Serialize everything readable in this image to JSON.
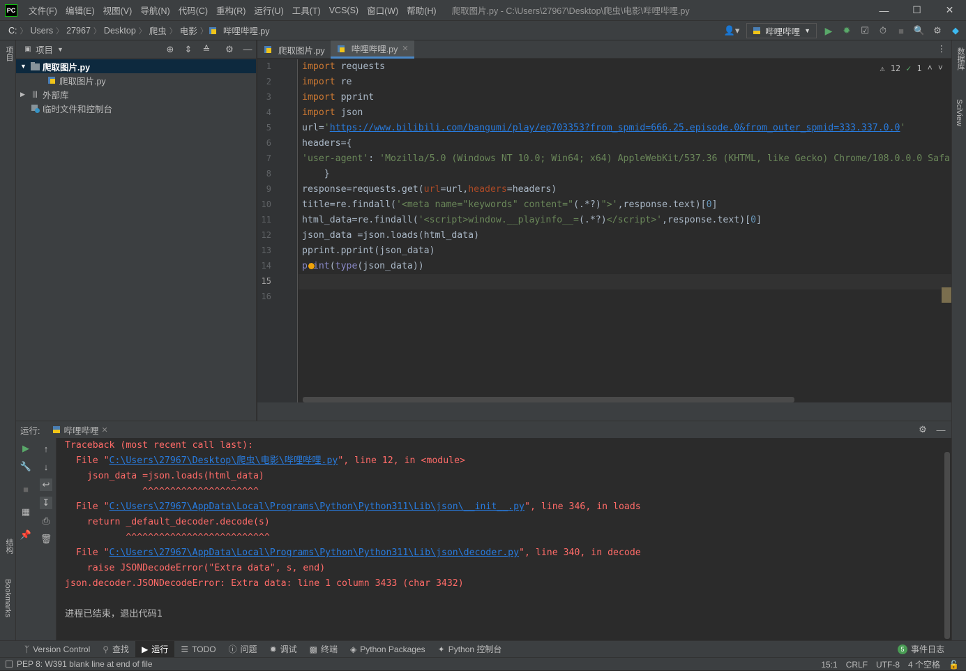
{
  "window": {
    "logo": "PC",
    "title": "爬取图片.py - C:\\Users\\27967\\Desktop\\爬虫\\电影\\哔哩哔哩.py",
    "menu": [
      "文件(F)",
      "编辑(E)",
      "视图(V)",
      "导航(N)",
      "代码(C)",
      "重构(R)",
      "运行(U)",
      "工具(T)",
      "VCS(S)",
      "窗口(W)",
      "帮助(H)"
    ]
  },
  "breadcrumb": {
    "drive": "C:",
    "items": [
      "Users",
      "27967",
      "Desktop",
      "爬虫",
      "电影"
    ],
    "file": "哔哩哔哩.py"
  },
  "toolbar": {
    "run_config": "哔哩哔哩"
  },
  "side_tabs": {
    "left_top": "项目",
    "left_structure": "结构",
    "left_bookmarks": "Bookmarks",
    "right_db": "数据库",
    "right_sciview": "SciView"
  },
  "project": {
    "header": "项目",
    "tree": [
      {
        "label": "爬取图片.py",
        "level": 0,
        "selected": true,
        "kind": "folder"
      },
      {
        "label": "爬取图片.py",
        "level": 1,
        "selected": false,
        "kind": "py"
      },
      {
        "label": "外部库",
        "level": 0,
        "selected": false,
        "kind": "lib"
      },
      {
        "label": "临时文件和控制台",
        "level": 0,
        "selected": false,
        "kind": "scratch"
      }
    ]
  },
  "editor": {
    "tabs": [
      {
        "label": "爬取图片.py",
        "active": false
      },
      {
        "label": "哔哩哔哩.py",
        "active": true
      }
    ],
    "inspections": {
      "warnings": "12",
      "typos": "1"
    },
    "line_numbers": [
      "1",
      "2",
      "3",
      "4",
      "5",
      "6",
      "7",
      "8",
      "9",
      "10",
      "11",
      "12",
      "13",
      "14",
      "15",
      "16"
    ]
  },
  "run": {
    "label": "运行:",
    "tab": "哔哩哔哩",
    "console": {
      "l1": "Traceback (most recent call last):",
      "l2a": "  File \"",
      "l2link": "C:\\Users\\27967\\Desktop\\爬虫\\电影\\哔哩哔哩.py",
      "l2b": "\", line 12, in <module>",
      "l3": "    json_data =json.loads(html_data)",
      "l4": "              ^^^^^^^^^^^^^^^^^^^^^",
      "l5a": "  File \"",
      "l5link": "C:\\Users\\27967\\AppData\\Local\\Programs\\Python\\Python311\\Lib\\json\\__init__.py",
      "l5b": "\", line 346, in loads",
      "l6": "    return _default_decoder.decode(s)",
      "l7": "           ^^^^^^^^^^^^^^^^^^^^^^^^^^",
      "l8a": "  File \"",
      "l8link": "C:\\Users\\27967\\AppData\\Local\\Programs\\Python\\Python311\\Lib\\json\\decoder.py",
      "l8b": "\", line 340, in decode",
      "l9": "    raise JSONDecodeError(\"Extra data\", s, end)",
      "l10": "json.decoder.JSONDecodeError: Extra data: line 1 column 3433 (char 3432)",
      "l12": "进程已结束，退出代码1"
    }
  },
  "bottom_tabs": [
    {
      "label": "Version Control",
      "icon": "branch-icon",
      "active": false
    },
    {
      "label": "查找",
      "icon": "search-icon",
      "active": false
    },
    {
      "label": "运行",
      "icon": "play-icon",
      "active": true
    },
    {
      "label": "TODO",
      "icon": "list-icon",
      "active": false
    },
    {
      "label": "问题",
      "icon": "info-icon",
      "active": false
    },
    {
      "label": "调试",
      "icon": "bug-icon",
      "active": false
    },
    {
      "label": "终端",
      "icon": "terminal-icon",
      "active": false
    },
    {
      "label": "Python Packages",
      "icon": "package-icon",
      "active": false
    },
    {
      "label": "Python 控制台",
      "icon": "python-icon",
      "active": false
    }
  ],
  "event_log": {
    "count": "5",
    "label": "事件日志"
  },
  "status": {
    "message": "PEP 8: W391 blank line at end of file",
    "position": "15:1",
    "line_sep": "CRLF",
    "encoding": "UTF-8",
    "indent": "4 个空格"
  }
}
